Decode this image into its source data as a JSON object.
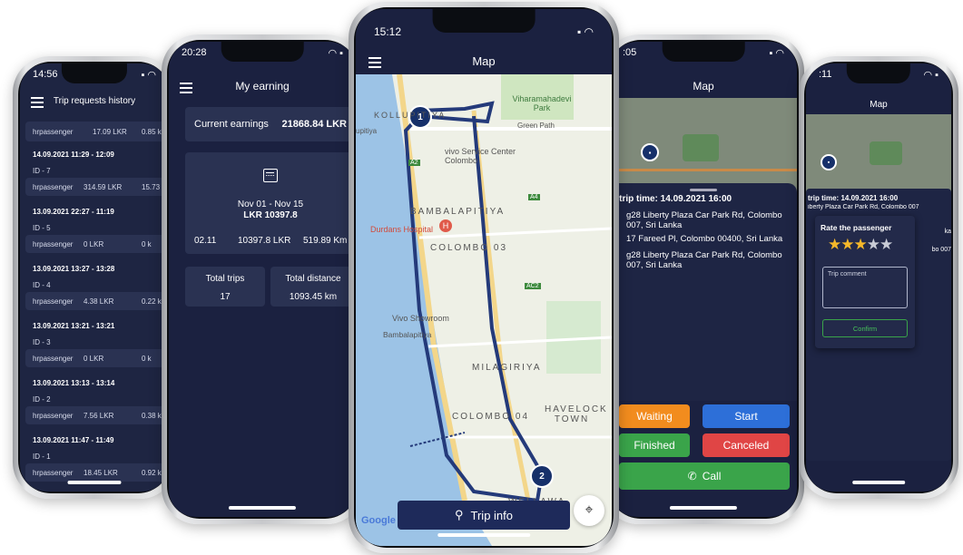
{
  "phone1": {
    "time": "14:56",
    "title": "Trip requests history",
    "top_row": {
      "name": "hrpassenger",
      "price": "17.09 LKR",
      "dist": "0.85 k"
    },
    "trips": [
      {
        "time": "14.09.2021 11:29 - 12:09",
        "id": "ID - 7",
        "name": "hrpassenger",
        "price": "314.59 LKR",
        "dist": "15.73 k"
      },
      {
        "time": "13.09.2021 22:27 - 11:19",
        "id": "ID - 5",
        "name": "hrpassenger",
        "price": "0 LKR",
        "dist": "0 k"
      },
      {
        "time": "13.09.2021 13:27 - 13:28",
        "id": "ID - 4",
        "name": "hrpassenger",
        "price": "4.38 LKR",
        "dist": "0.22 k"
      },
      {
        "time": "13.09.2021 13:21 - 13:21",
        "id": "ID - 3",
        "name": "hrpassenger",
        "price": "0 LKR",
        "dist": "0 k"
      },
      {
        "time": "13.09.2021 13:13 - 13:14",
        "id": "ID - 2",
        "name": "hrpassenger",
        "price": "7.56 LKR",
        "dist": "0.38 k"
      },
      {
        "time": "13.09.2021 11:47 - 11:49",
        "id": "ID - 1",
        "name": "hrpassenger",
        "price": "18.45 LKR",
        "dist": "0.92 k"
      }
    ]
  },
  "phone2": {
    "time": "20:28",
    "title": "My earning",
    "current_label": "Current earnings",
    "current_value": "21868.84 LKR",
    "period": "Nov 01 - Nov 15",
    "period_total": "LKR 10397.8",
    "row": {
      "col1": "02.11",
      "col2": "10397.8 LKR",
      "col3": "519.89 Km"
    },
    "total_trips_label": "Total trips",
    "total_trips_value": "17",
    "total_distance_label": "Total distance",
    "total_distance_value": "1093.45 km"
  },
  "phone3": {
    "time": "15:12",
    "title": "Map",
    "trip_info": "Trip info",
    "google": "Google",
    "map_labels": {
      "kollupitiya": "KOLLUPITIYA",
      "vihara": "Viharamahadevi Park",
      "green_path": "Green Path",
      "vivo_service": "vivo Service Center Colombo",
      "pitiya": "upitiya",
      "bambalapitiya": "BAMBALAPITIYA",
      "durdans": "Durdans Hospital",
      "colombo03": "COLOMBO 03",
      "vivo_showroom": "Vivo Showroom",
      "bambalapitiya_stn": "Bambalapitiya",
      "milagiriya": "MILAGIRIYA",
      "havelock": "HAVELOCK TOWN",
      "colombo04": "COLOMBO 04",
      "wellawa": "WELLAWA",
      "a2": "A2",
      "a4": "A4",
      "ac2": "AC2"
    },
    "pin1": "1",
    "pin2": "2"
  },
  "phone4": {
    "time": ":05",
    "title": "Map",
    "start_time": "t trip time: 14.09.2021 16:00",
    "addr1": "g28 Liberty Plaza Car Park Rd, Colombo 007, Sri Lanka",
    "addr2": "17 Fareed Pl, Colombo 00400, Sri Lanka",
    "addr3": "g28 Liberty Plaza Car Park Rd, Colombo 007, Sri Lanka",
    "waiting": "Waiting",
    "start": "Start",
    "finished": "Finished",
    "canceled": "Canceled",
    "call": "Call",
    "colors": {
      "waiting": "#f28c1e",
      "start": "#2d6fd8",
      "finished": "#3aa44a",
      "canceled": "#e04545",
      "call": "#3aa44a"
    }
  },
  "phone5": {
    "time": ":11",
    "title": "Map",
    "start_time": "trip time: 14.09.2021 16:00",
    "addr": "iberty Plaza Car Park Rd, Colombo 007",
    "side1": "ka",
    "side2": "bo 007",
    "rate_title": "Rate the passenger",
    "rating": 3,
    "max_rating": 5,
    "comment_placeholder": "Trip comment",
    "confirm": "Confirm"
  }
}
